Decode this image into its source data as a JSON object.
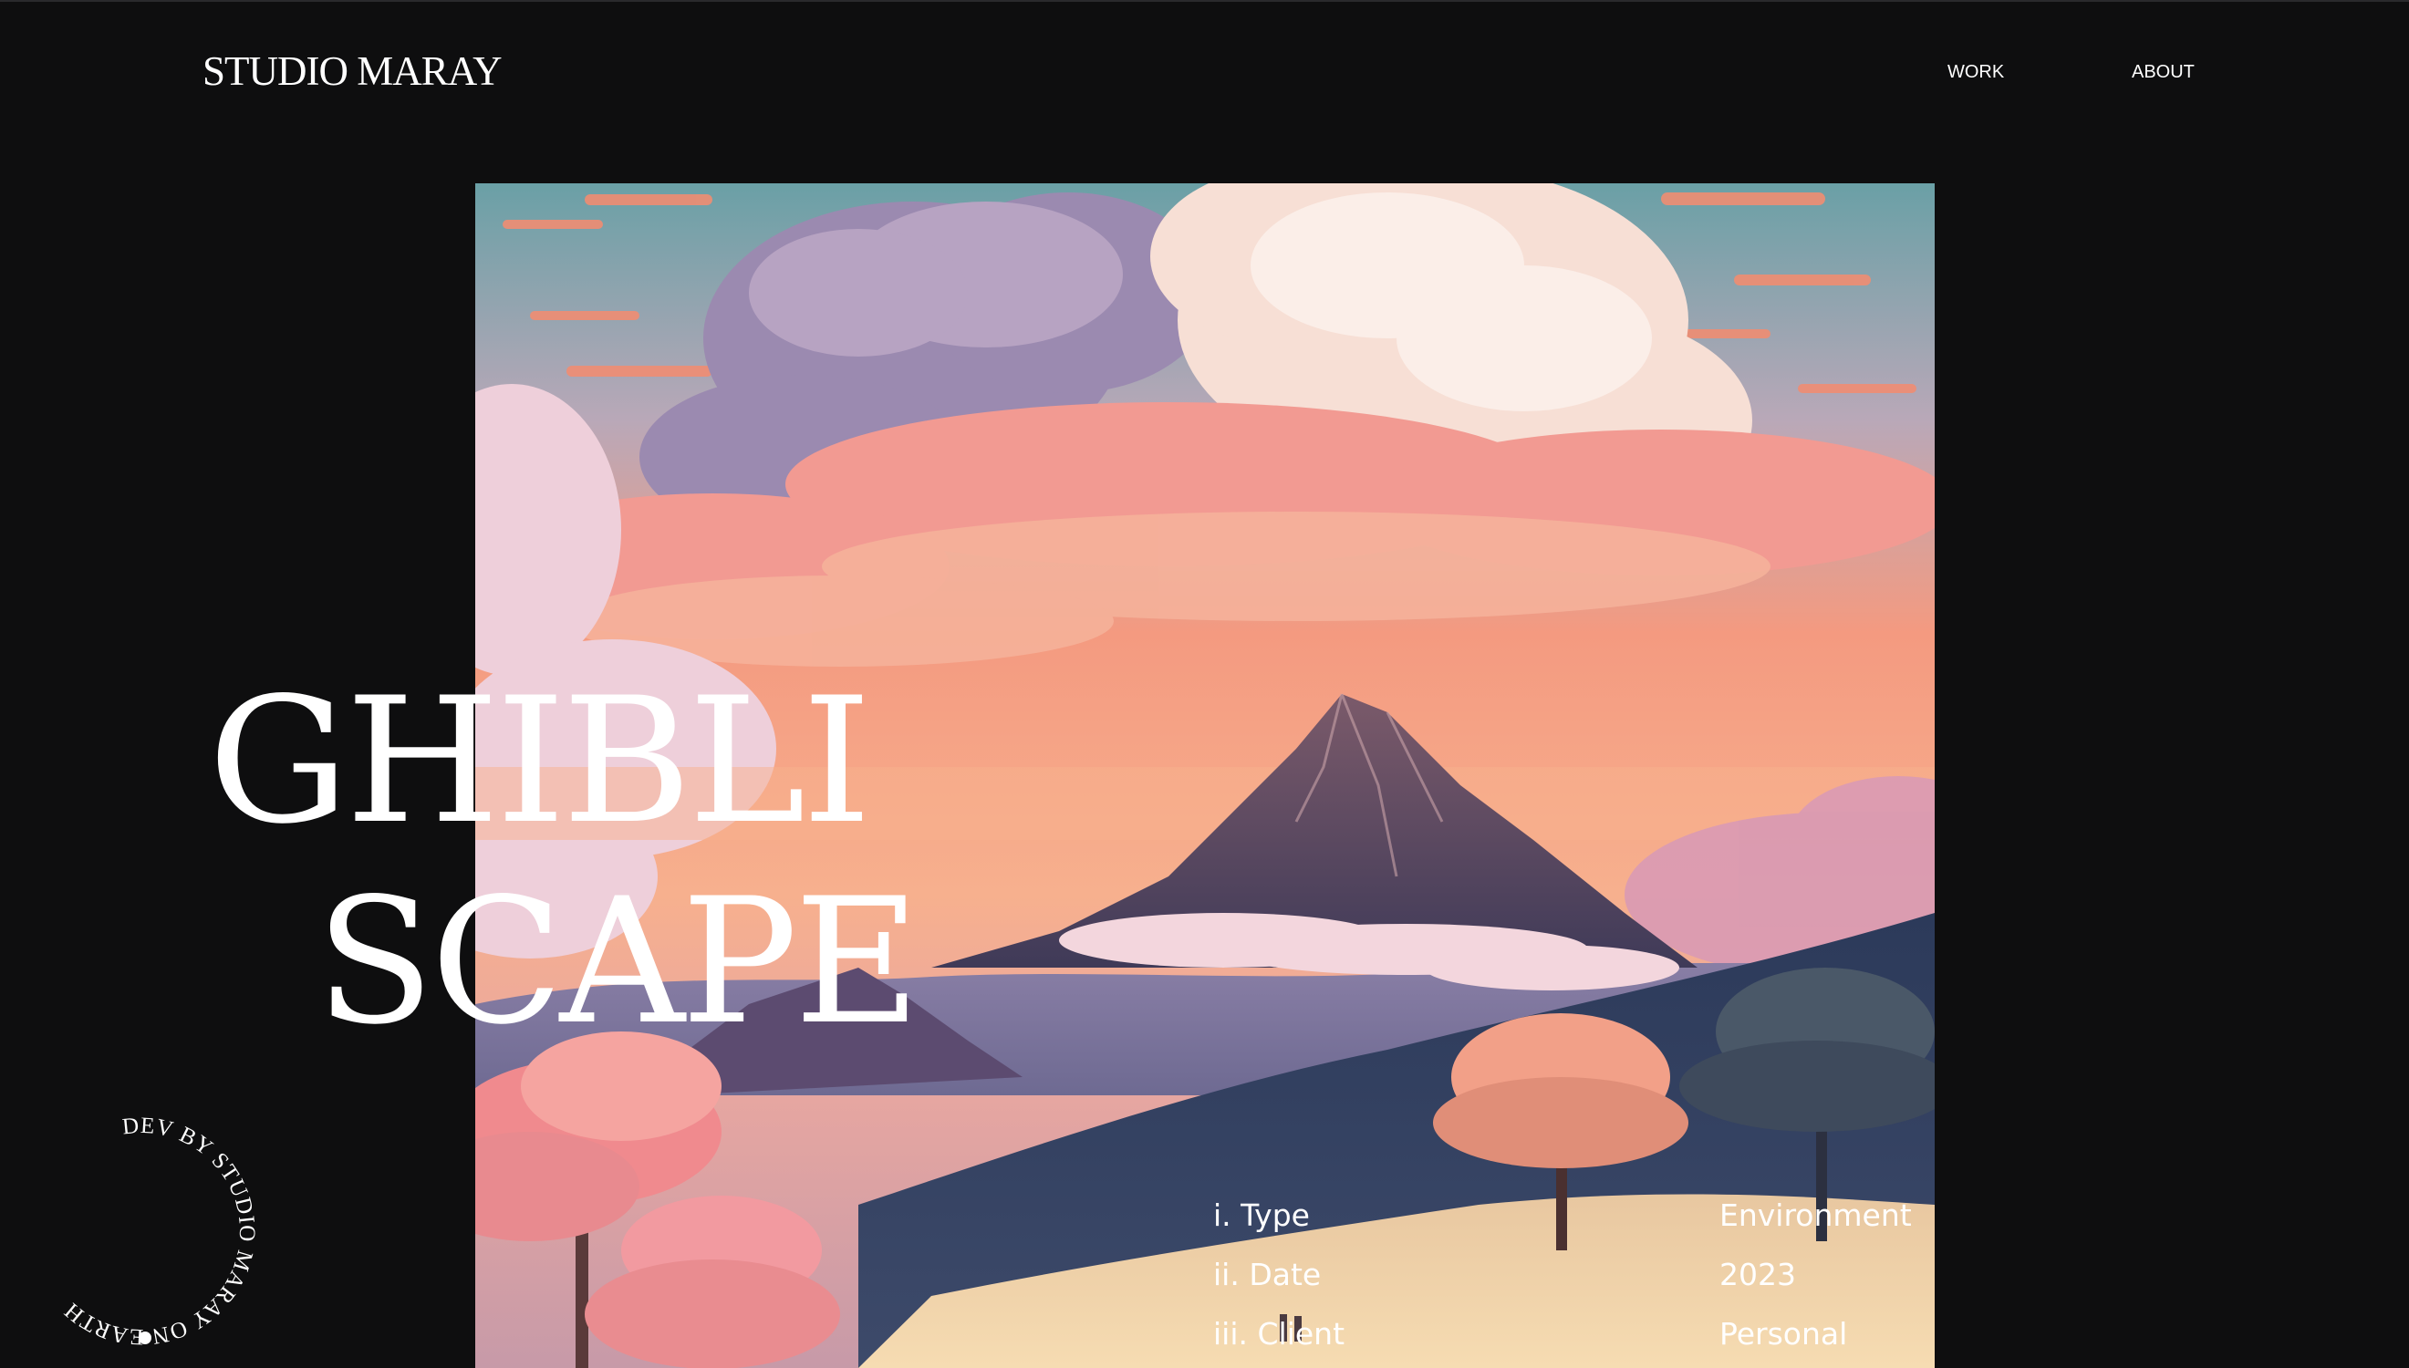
{
  "header": {
    "logo": "STUDIO MARAY",
    "nav": [
      {
        "label": "WORK"
      },
      {
        "label": "ABOUT"
      }
    ]
  },
  "hero": {
    "title_line1": "GHIBLI",
    "title_line2": "SCAPE",
    "image_description_icon": "landscape-illustration"
  },
  "project_meta": {
    "labels": [
      "i. Type",
      "ii. Date",
      "iii. Client"
    ],
    "values": [
      "Environment",
      "2023",
      "Personal"
    ]
  },
  "badge": {
    "text": "DEV BY STUDIO MARAY ON EARTH"
  },
  "colors": {
    "background": "#0e0e0f",
    "text": "#ffffff",
    "sky_top": "#6fa5a8",
    "sky_warm": "#f5967a",
    "mountain": "#5a4660"
  }
}
